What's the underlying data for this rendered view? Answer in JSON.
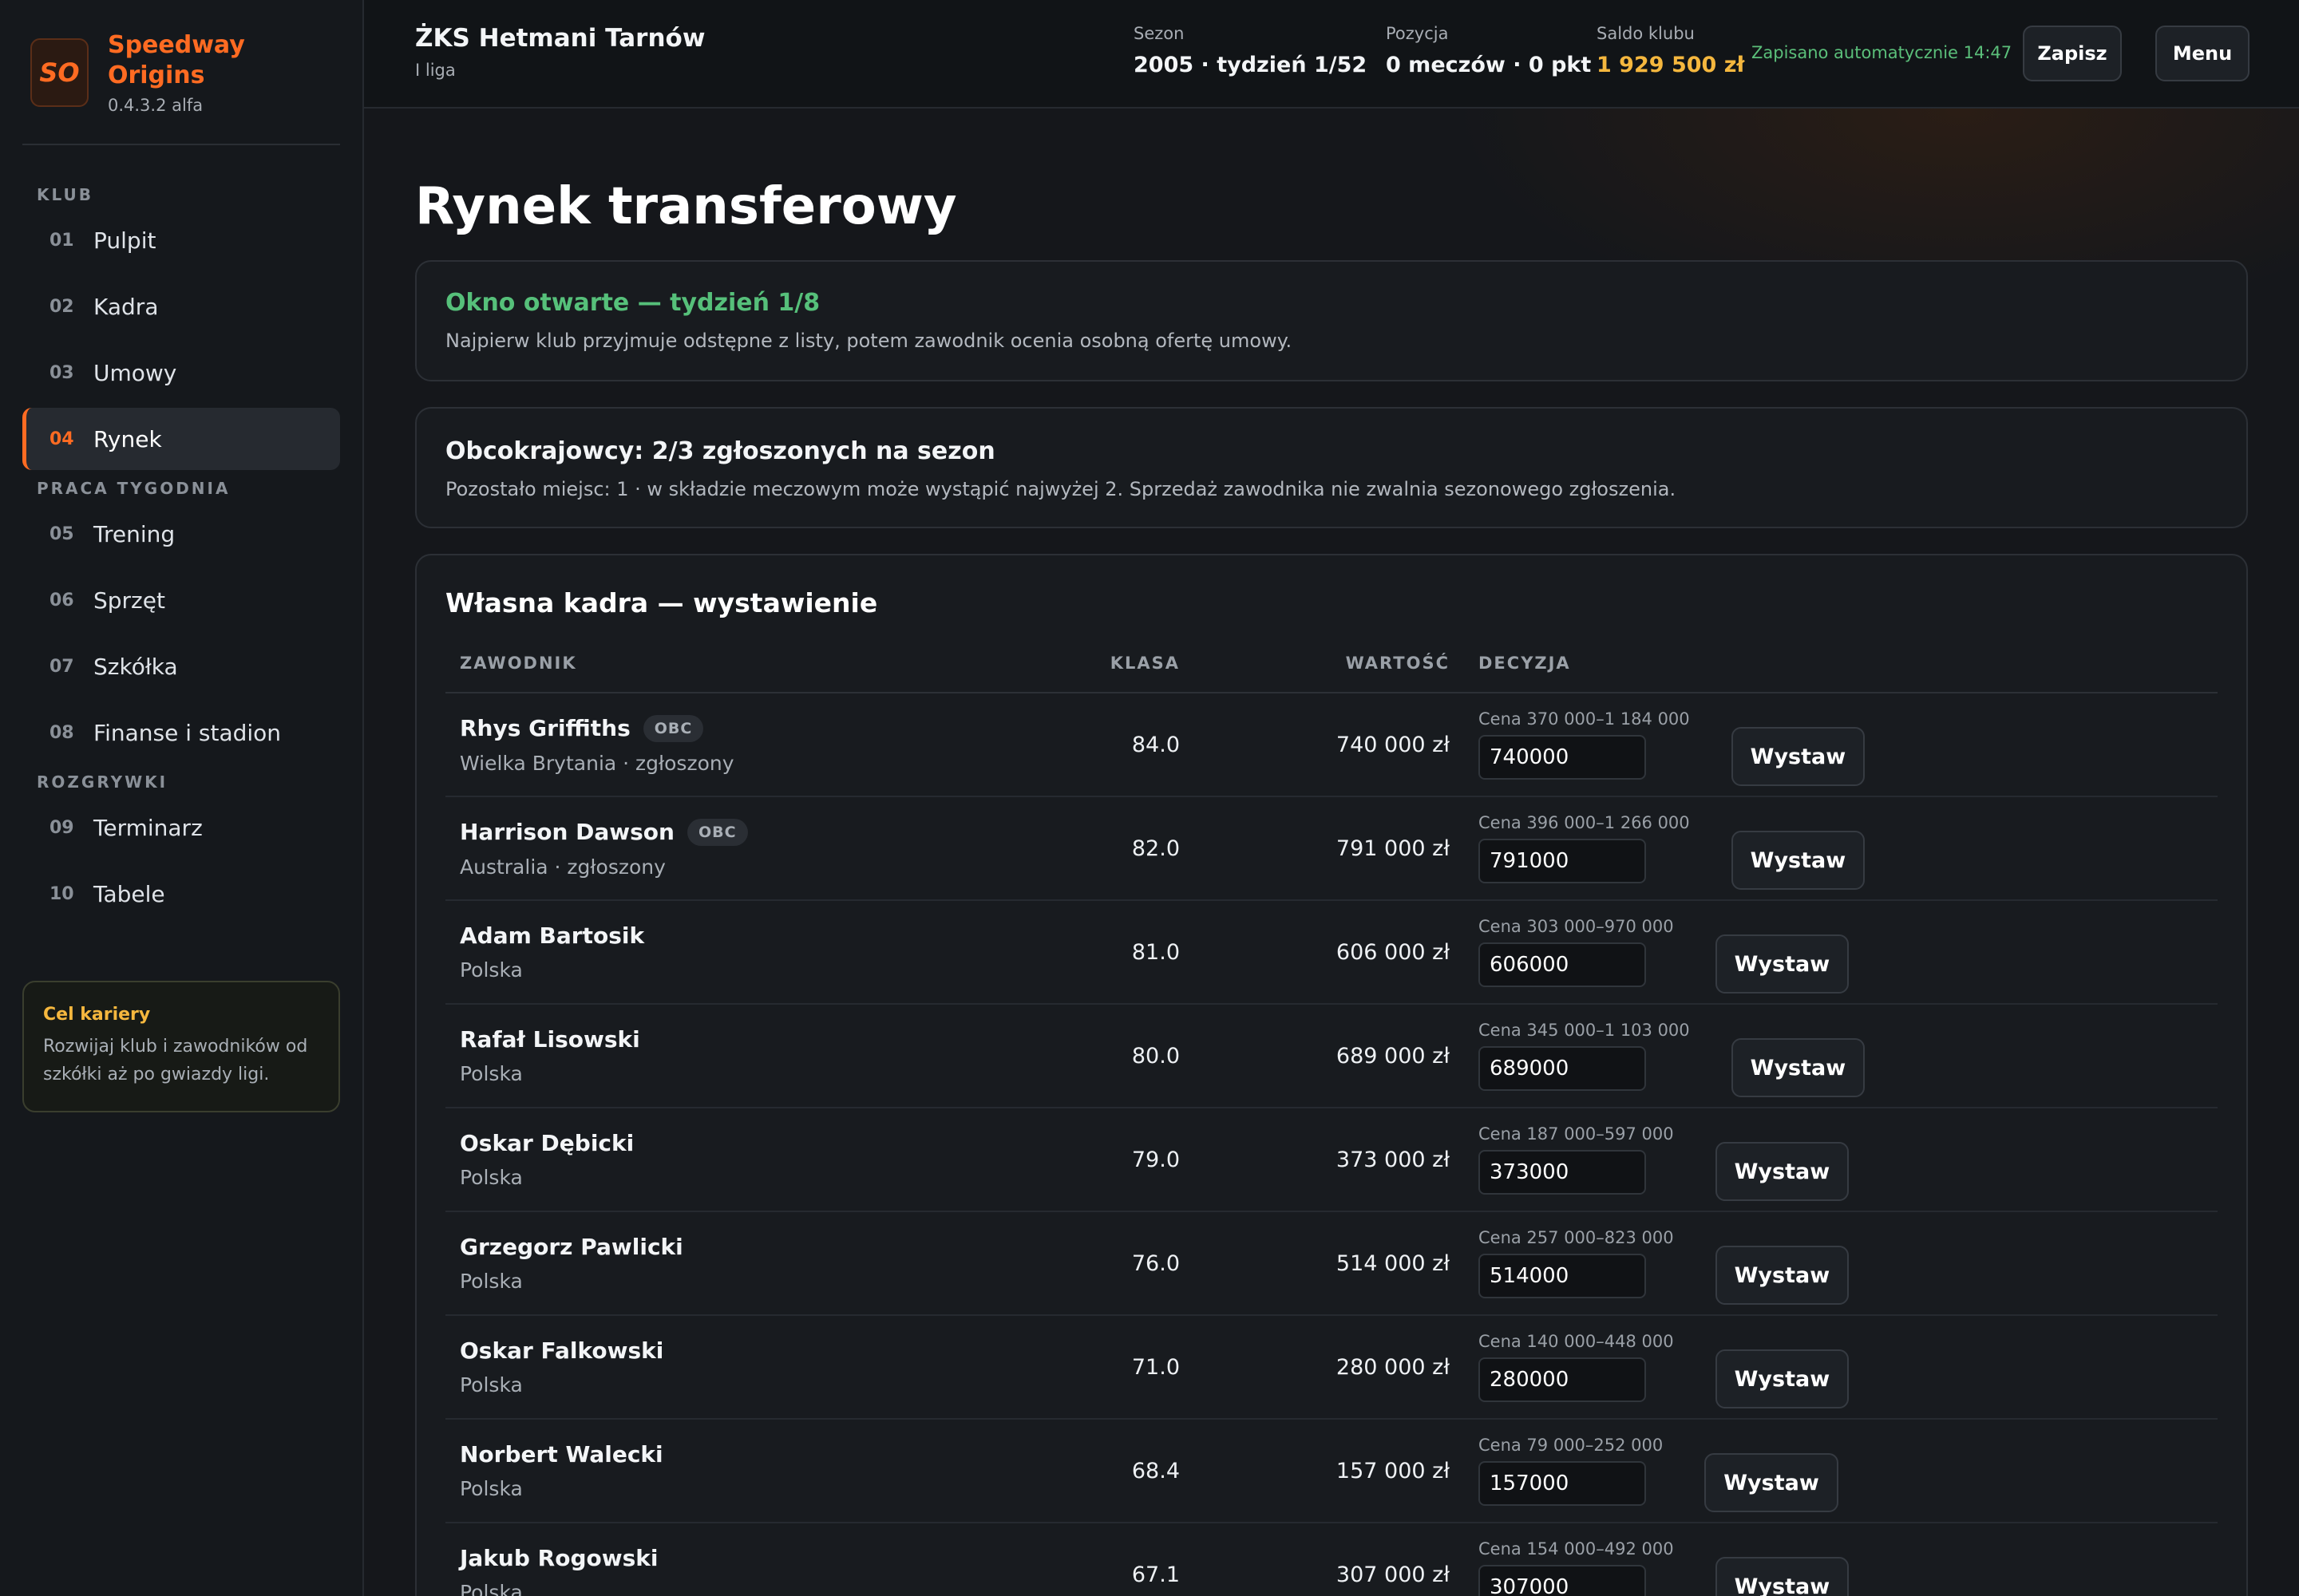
{
  "brand": {
    "logo": "SO",
    "title": "Speedway Origins",
    "version": "0.4.3.2 alfa"
  },
  "sidebar": {
    "groups": [
      {
        "label": "KLUB",
        "items": [
          {
            "num": "01",
            "label": "Pulpit"
          },
          {
            "num": "02",
            "label": "Kadra"
          },
          {
            "num": "03",
            "label": "Umowy"
          },
          {
            "num": "04",
            "label": "Rynek",
            "active": true
          }
        ]
      },
      {
        "label": "PRACA TYGODNIA",
        "items": [
          {
            "num": "05",
            "label": "Trening"
          },
          {
            "num": "06",
            "label": "Sprzęt"
          },
          {
            "num": "07",
            "label": "Szkółka"
          },
          {
            "num": "08",
            "label": "Finanse i stadion"
          }
        ]
      },
      {
        "label": "ROZGRYWKI",
        "items": [
          {
            "num": "09",
            "label": "Terminarz"
          },
          {
            "num": "10",
            "label": "Tabele"
          }
        ]
      }
    ],
    "goal": {
      "title": "Cel kariery",
      "text": "Rozwijaj klub i zawodników od szkółki aż po gwiazdy ligi."
    }
  },
  "header": {
    "club_name": "ŻKS Hetmani Tarnów",
    "league": "I liga",
    "season_label": "Sezon",
    "season_value": "2005 · tydzień 1/52",
    "position_label": "Pozycja",
    "position_value": "0 meczów · 0 pkt",
    "balance_label": "Saldo klubu",
    "balance_value": "1 929 500 zł",
    "autosave": "Zapisano automatycznie 14:47",
    "save_label": "Zapisz",
    "menu_label": "Menu"
  },
  "page": {
    "title": "Rynek transferowy",
    "window_card": {
      "title": "Okno otwarte — tydzień 1/8",
      "desc": "Najpierw klub przyjmuje odstępne z listy, potem zawodnik ocenia osobną ofertę umowy."
    },
    "foreign_card": {
      "title": "Obcokrajowcy: 2/3 zgłoszonych na sezon",
      "desc": "Pozostało miejsc: 1 · w składzie meczowym może wystąpić najwyżej 2. Sprzedaż zawodnika nie zwalnia sezonowego zgłoszenia."
    },
    "squad_card": {
      "title": "Własna kadra — wystawienie",
      "columns": {
        "player": "ZAWODNIK",
        "klasa": "KLASA",
        "value": "WARTOŚĆ",
        "decision": "DECYZJA"
      },
      "button_label": "Wystaw",
      "rows": [
        {
          "name": "Rhys Griffiths",
          "badge": "OBC",
          "sub": "Wielka Brytania · zgłoszony",
          "klasa": "84.0",
          "value": "740 000 zł",
          "range": "Cena 370 000–1 184 000",
          "price": "740000"
        },
        {
          "name": "Harrison Dawson",
          "badge": "OBC",
          "sub": "Australia · zgłoszony",
          "klasa": "82.0",
          "value": "791 000 zł",
          "range": "Cena 396 000–1 266 000",
          "price": "791000"
        },
        {
          "name": "Adam Bartosik",
          "badge": "",
          "sub": "Polska",
          "klasa": "81.0",
          "value": "606 000 zł",
          "range": "Cena 303 000–970 000",
          "price": "606000"
        },
        {
          "name": "Rafał Lisowski",
          "badge": "",
          "sub": "Polska",
          "klasa": "80.0",
          "value": "689 000 zł",
          "range": "Cena 345 000–1 103 000",
          "price": "689000"
        },
        {
          "name": "Oskar Dębicki",
          "badge": "",
          "sub": "Polska",
          "klasa": "79.0",
          "value": "373 000 zł",
          "range": "Cena 187 000–597 000",
          "price": "373000"
        },
        {
          "name": "Grzegorz Pawlicki",
          "badge": "",
          "sub": "Polska",
          "klasa": "76.0",
          "value": "514 000 zł",
          "range": "Cena 257 000–823 000",
          "price": "514000"
        },
        {
          "name": "Oskar Falkowski",
          "badge": "",
          "sub": "Polska",
          "klasa": "71.0",
          "value": "280 000 zł",
          "range": "Cena 140 000–448 000",
          "price": "280000"
        },
        {
          "name": "Norbert Walecki",
          "badge": "",
          "sub": "Polska",
          "klasa": "68.4",
          "value": "157 000 zł",
          "range": "Cena 79 000–252 000",
          "price": "157000"
        },
        {
          "name": "Jakub Rogowski",
          "badge": "",
          "sub": "Polska",
          "klasa": "67.1",
          "value": "307 000 zł",
          "range": "Cena 154 000–492 000",
          "price": "307000"
        }
      ]
    }
  }
}
